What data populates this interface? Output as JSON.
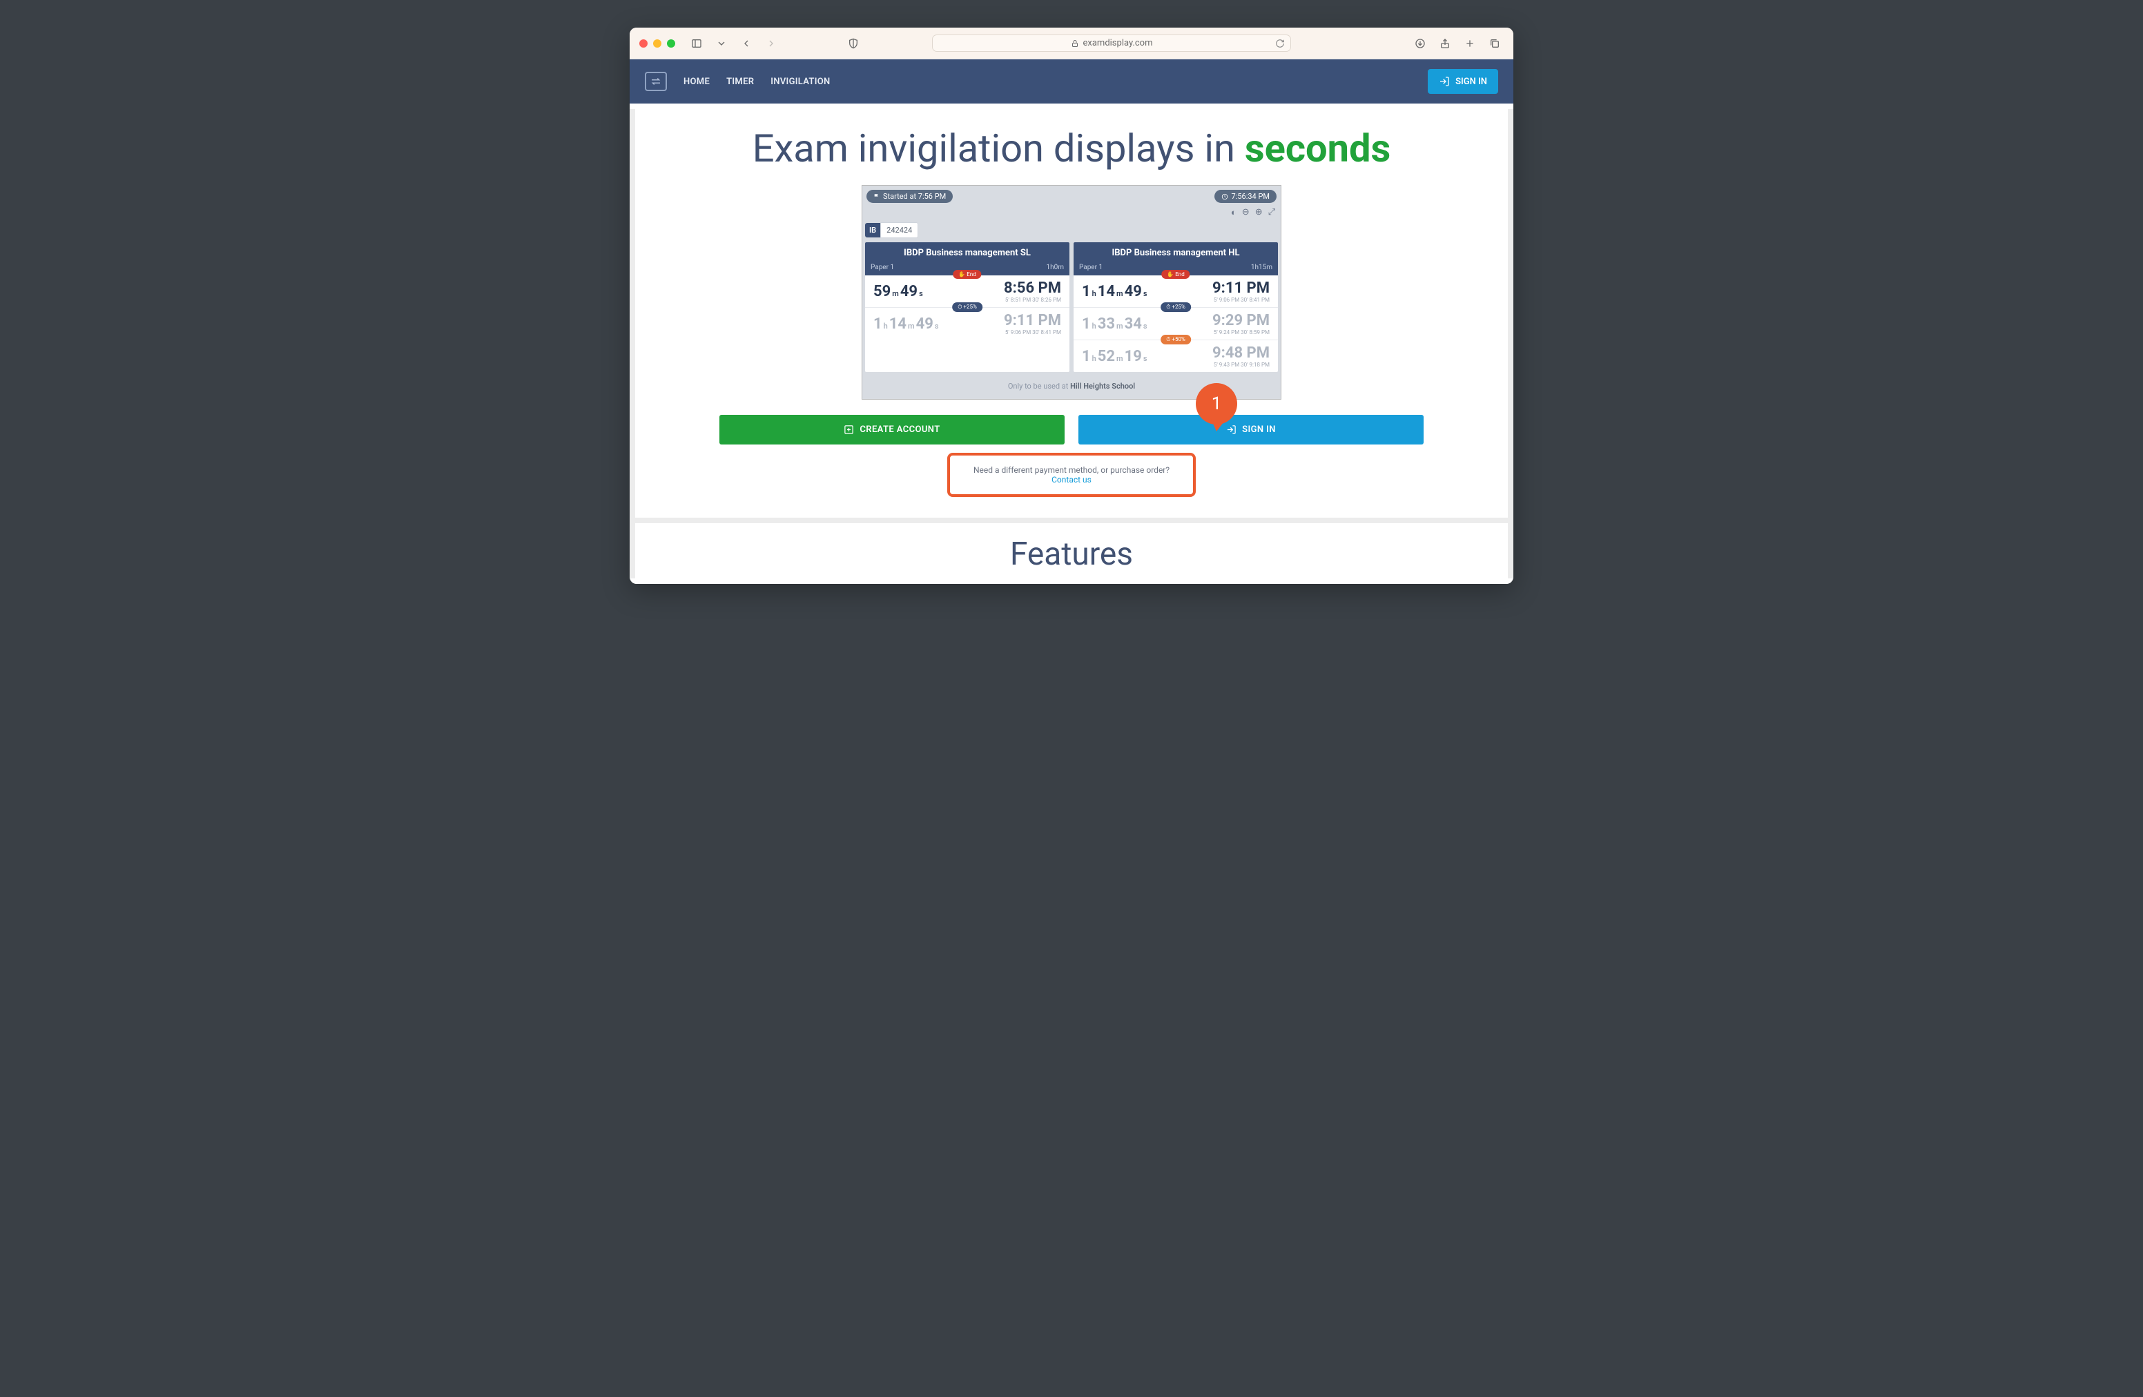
{
  "browser": {
    "url": "examdisplay.com"
  },
  "nav": {
    "home": "HOME",
    "timer": "TIMER",
    "invigilation": "INVIGILATION",
    "signin": "SIGN IN"
  },
  "hero": {
    "title_prefix": "Exam invigilation displays in ",
    "title_accent": "seconds"
  },
  "demo": {
    "started_label": "Started at 7:56 PM",
    "clock": "7:56:34 PM",
    "ib_badge": "IB",
    "ib_code": "242424",
    "footer_prefix": "Only to be used at ",
    "footer_school": "Hill Heights School",
    "cards": [
      {
        "title": "IBDP Business management SL",
        "paper": "Paper 1",
        "duration": "1h0m",
        "rows": [
          {
            "badge": {
              "type": "end",
              "text": "End"
            },
            "left_h": "",
            "left_m": "59",
            "left_s": "49",
            "right_big": "8:56 PM",
            "right_small": "5' 8:51 PM   30' 8:26 PM",
            "dim": false
          },
          {
            "badge": {
              "type": "plus25",
              "text": "+25%"
            },
            "left_h": "1",
            "left_m": "14",
            "left_s": "49",
            "right_big": "9:11 PM",
            "right_small": "5' 9:06 PM   30' 8:41 PM",
            "dim": true
          }
        ]
      },
      {
        "title": "IBDP Business management HL",
        "paper": "Paper 1",
        "duration": "1h15m",
        "rows": [
          {
            "badge": {
              "type": "end",
              "text": "End"
            },
            "left_h": "1",
            "left_m": "14",
            "left_s": "49",
            "right_big": "9:11 PM",
            "right_small": "5' 9:06 PM   30' 8:41 PM",
            "dim": false
          },
          {
            "badge": {
              "type": "plus25",
              "text": "+25%"
            },
            "left_h": "1",
            "left_m": "33",
            "left_s": "34",
            "right_big": "9:29 PM",
            "right_small": "5' 9:24 PM   30' 8:59 PM",
            "dim": true
          },
          {
            "badge": {
              "type": "plus50",
              "text": "+50%"
            },
            "left_h": "1",
            "left_m": "52",
            "left_s": "19",
            "right_big": "9:48 PM",
            "right_small": "5' 9:43 PM   30' 9:18 PM",
            "dim": true
          }
        ]
      }
    ]
  },
  "cta": {
    "create": "CREATE ACCOUNT",
    "signin": "SIGN IN",
    "annotation": "1",
    "contact_prefix": "Need a different payment method, or purchase order? ",
    "contact_link": "Contact us"
  },
  "features": {
    "heading": "Features"
  }
}
